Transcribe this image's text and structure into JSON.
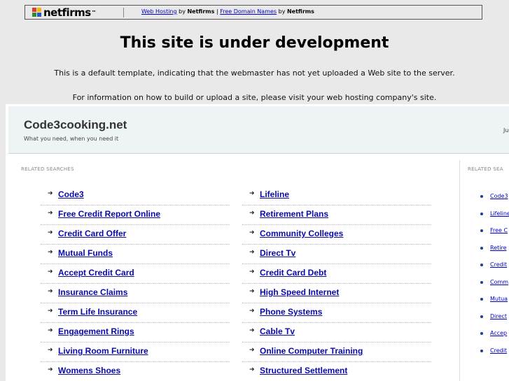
{
  "topbar": {
    "logo": "netfirms",
    "link1": "Web Hosting",
    "by1": "by",
    "brand1": "Netfirms",
    "sep": "|",
    "link2": "Free Domain Names",
    "by2": "by",
    "brand2": "Netfirms"
  },
  "headline": "This site is under development",
  "notice1": "This is a default template, indicating that the webmaster has not yet uploaded a Web site to the server.",
  "notice2": "For information on how to build or upload a site, please visit your web hosting company's site.",
  "frame": {
    "site_title": "Code3cooking.net",
    "site_tagline": "What you need, when you need it",
    "date": "Ju",
    "related_label": "RELATED SEARCHES",
    "side_label": "RELATED SEA",
    "left_items": [
      "Code3",
      "Free Credit Report Online",
      "Credit Card Offer",
      "Mutual Funds",
      "Accept Credit Card",
      "Insurance Claims",
      "Term Life Insurance",
      "Engagement Rings",
      "Living Room Furniture",
      "Womens Shoes"
    ],
    "right_items": [
      "Lifeline",
      "Retirement Plans",
      "Community Colleges",
      "Direct Tv",
      "Credit Card Debt",
      "High Speed Internet",
      "Phone Systems",
      "Cable Tv",
      "Online Computer Training",
      "Structured Settlement"
    ],
    "side_items": [
      "Code3",
      "Lifeline",
      "Free C",
      "Retire",
      "Credit",
      "Comm",
      "Mutua",
      "Direct",
      "Accep",
      "Credit"
    ]
  }
}
